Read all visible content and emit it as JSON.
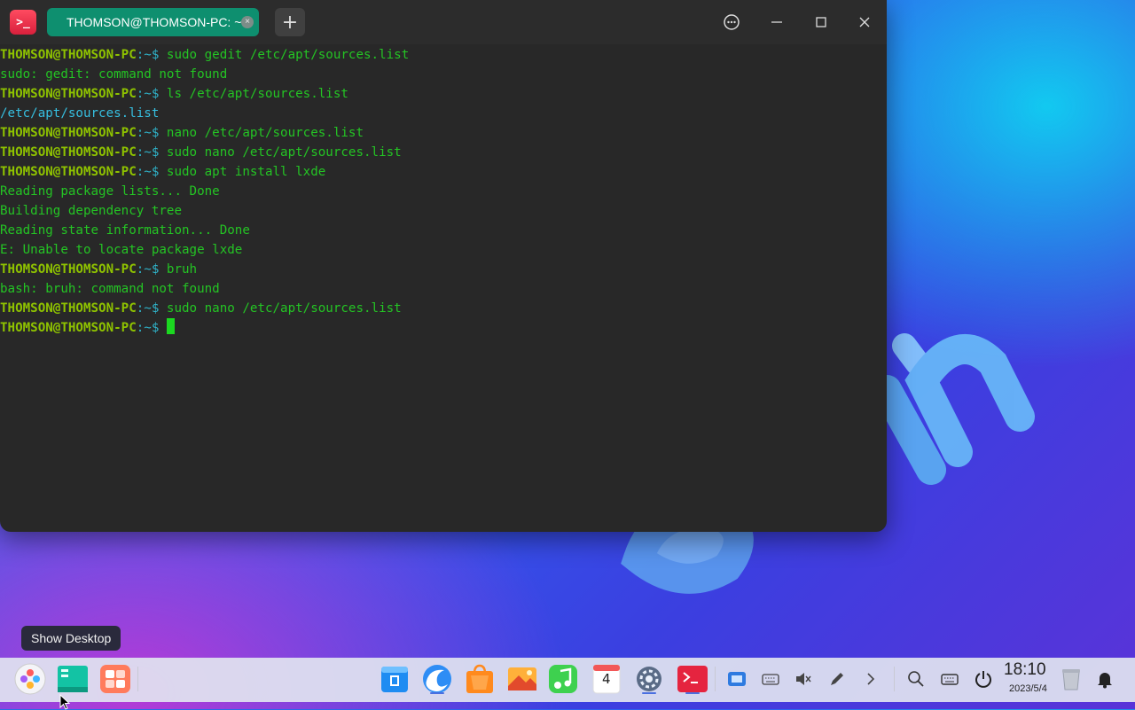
{
  "terminal": {
    "app_icon": "terminal-icon",
    "tab_title": "THOMSON@THOMSON-PC: ~",
    "tab_close": "×",
    "new_tab": "+",
    "prompt_user": "THOMSON@THOMSON-PC",
    "prompt_sep": ":",
    "prompt_path": "~$ ",
    "lines": [
      {
        "type": "cmd",
        "text": "sudo gedit /etc/apt/sources.list"
      },
      {
        "type": "out",
        "text": "sudo: gedit: command not found"
      },
      {
        "type": "cmd",
        "text": "ls /etc/apt/sources.list"
      },
      {
        "type": "cyan",
        "text": "/etc/apt/sources.list"
      },
      {
        "type": "cmd",
        "text": "nano /etc/apt/sources.list"
      },
      {
        "type": "cmd",
        "text": "sudo nano /etc/apt/sources.list"
      },
      {
        "type": "cmd",
        "text": "sudo apt install lxde"
      },
      {
        "type": "out",
        "text": "Reading package lists... Done"
      },
      {
        "type": "out",
        "text": "Building dependency tree"
      },
      {
        "type": "out",
        "text": "Reading state information... Done"
      },
      {
        "type": "out",
        "text": "E: Unable to locate package lxde"
      },
      {
        "type": "cmd",
        "text": "bruh"
      },
      {
        "type": "out",
        "text": "bash: bruh: command not found"
      },
      {
        "type": "cmd",
        "text": "sudo nano /etc/apt/sources.list"
      },
      {
        "type": "cmd",
        "text": "",
        "cursor": true
      }
    ]
  },
  "tooltip": "Show Desktop",
  "tray": {
    "time": "18:10",
    "date": "2023/5/4"
  },
  "dock_calendar_day": "4",
  "colors": {
    "accent_tab": "#0e8f6f",
    "prompt": "#8fc300",
    "output": "#24c424"
  }
}
